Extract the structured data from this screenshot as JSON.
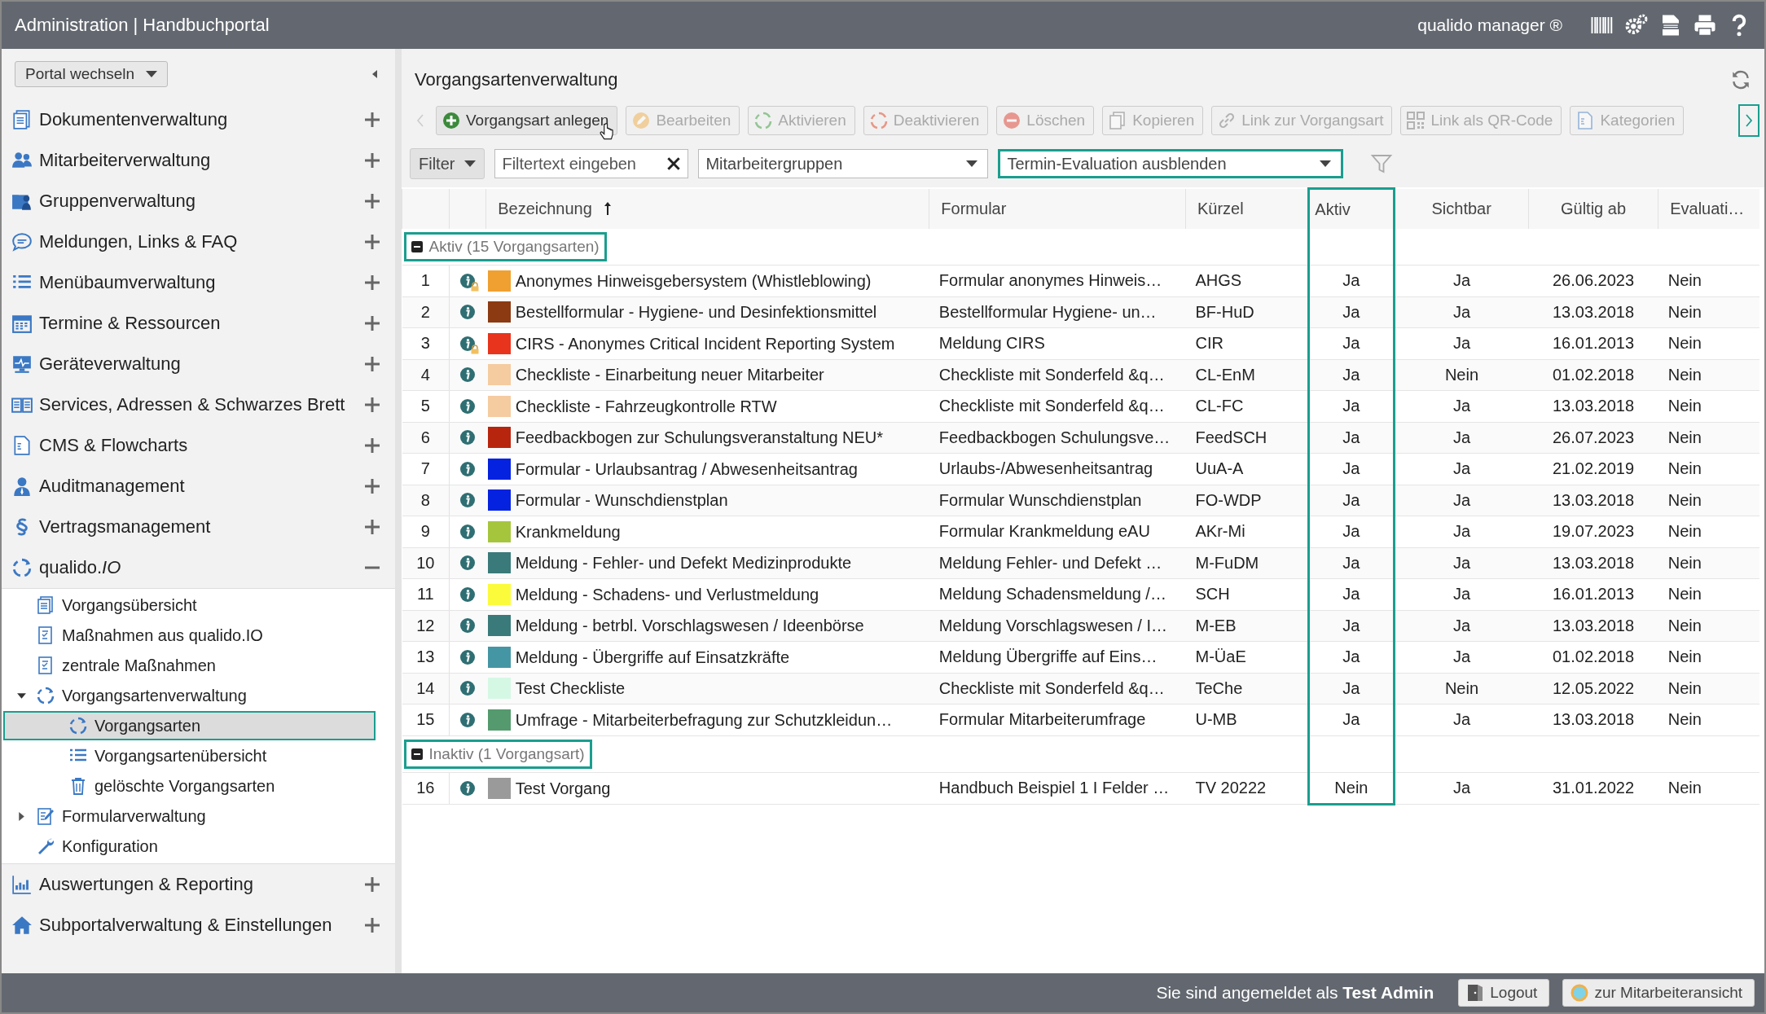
{
  "header": {
    "title": "Administration | Handbuchportal",
    "product": "qualido manager ®"
  },
  "sidebar": {
    "portal_button": "Portal wechseln",
    "items": [
      {
        "label": "Dokumentenverwaltung",
        "expanded": false
      },
      {
        "label": "Mitarbeiterverwaltung",
        "expanded": false
      },
      {
        "label": "Gruppenverwaltung",
        "expanded": false
      },
      {
        "label": "Meldungen, Links & FAQ",
        "expanded": false
      },
      {
        "label": "Menübaumverwaltung",
        "expanded": false
      },
      {
        "label": "Termine & Ressourcen",
        "expanded": false
      },
      {
        "label": "Geräteverwaltung",
        "expanded": false
      },
      {
        "label": "Services, Adressen & Schwarzes Brett",
        "expanded": false
      },
      {
        "label": "CMS & Flowcharts",
        "expanded": false
      },
      {
        "label": "Auditmanagement",
        "expanded": false
      },
      {
        "label": "Vertragsmanagement",
        "expanded": false
      },
      {
        "label": "qualido.*IO*",
        "expanded": true,
        "children": [
          {
            "label": "Vorgangsübersicht",
            "selected": false
          },
          {
            "label": "Maßnahmen aus qualido.IO",
            "selected": false
          },
          {
            "label": "zentrale Maßnahmen",
            "selected": false
          },
          {
            "label": "Vorgangsartenverwaltung",
            "selected": false,
            "expanded": true,
            "children": [
              {
                "label": "Vorgangsarten",
                "selected": true
              },
              {
                "label": "Vorgangsartenübersicht",
                "selected": false
              },
              {
                "label": "gelöschte Vorgangsarten",
                "selected": false
              }
            ]
          },
          {
            "label": "Formularverwaltung",
            "selected": false,
            "expanded": false
          },
          {
            "label": "Konfiguration",
            "selected": false
          }
        ]
      },
      {
        "label": "Auswertungen & Reporting",
        "expanded": false
      },
      {
        "label": "Subportalverwaltung & Einstellungen",
        "expanded": false
      }
    ]
  },
  "main": {
    "title": "Vorgangsartenverwaltung",
    "toolbar": {
      "scroll_left": {
        "disabled": true
      },
      "scroll_right": {
        "highlighted": true
      },
      "buttons": [
        {
          "label": "Vorgangsart anlegen",
          "disabled": false
        },
        {
          "label": "Bearbeiten",
          "disabled": true
        },
        {
          "label": "Aktivieren",
          "disabled": true
        },
        {
          "label": "Deaktivieren",
          "disabled": true
        },
        {
          "label": "Löschen",
          "disabled": true
        },
        {
          "label": "Kopieren",
          "disabled": true
        },
        {
          "label": "Link zur Vorgangsart",
          "disabled": true
        },
        {
          "label": "Link als QR-Code",
          "disabled": true
        },
        {
          "label": "Kategorien",
          "disabled": true
        }
      ]
    },
    "filters": {
      "filter_button": "Filter",
      "text_field": {
        "placeholder": "Filtertext eingeben"
      },
      "group_select": {
        "value": "Mitarbeitergruppen",
        "highlighted": false
      },
      "evaluation_select": {
        "value": "Termin-Evaluation ausblenden",
        "highlighted": true
      }
    },
    "table": {
      "columns": [
        {
          "highlighted": false
        },
        {
          "highlighted": false
        },
        {
          "label": "Bezeichnung",
          "sorted": true,
          "highlighted": false
        },
        {
          "label": "Formular",
          "highlighted": false
        },
        {
          "label": "Kürzel",
          "highlighted": false
        },
        {
          "label": "Aktiv",
          "highlighted": true
        },
        {
          "label": "Sichtbar",
          "highlighted": false
        },
        {
          "label": "Gültig ab",
          "highlighted": false
        },
        {
          "label": "Evaluati…",
          "highlighted": false
        }
      ],
      "groups": [
        {
          "label": "Aktiv (15 Vorgangsarten)",
          "expanded": true,
          "highlighted": true,
          "rows": [
            {
              "nr": "1",
              "locked": true,
              "color": "#f0a030",
              "name": "Anonymes Hinweisgebersystem (Whistleblowing)",
              "form": "Formular anonymes Hinweis…",
              "short": "AHGS",
              "active": "Ja",
              "visible": "Ja",
              "valid": "26.06.2023",
              "eval": "Nein"
            },
            {
              "nr": "2",
              "locked": false,
              "color": "#8b3a12",
              "name": "Bestellformular - Hygiene- und Desinfektionsmittel",
              "form": "Bestellformular Hygiene- un…",
              "short": "BF-HuD",
              "active": "Ja",
              "visible": "Ja",
              "valid": "13.03.2018",
              "eval": "Nein"
            },
            {
              "nr": "3",
              "locked": true,
              "color": "#e8341c",
              "name": "CIRS - Anonymes Critical Incident Reporting System",
              "form": "Meldung CIRS",
              "short": "CIR",
              "active": "Ja",
              "visible": "Ja",
              "valid": "16.01.2013",
              "eval": "Nein"
            },
            {
              "nr": "4",
              "locked": false,
              "color": "#f5cba0",
              "name": "Checkliste - Einarbeitung neuer Mitarbeiter",
              "form": "Checkliste mit Sonderfeld &q…",
              "short": "CL-EnM",
              "active": "Ja",
              "visible": "Nein",
              "valid": "01.02.2018",
              "eval": "Nein"
            },
            {
              "nr": "5",
              "locked": false,
              "color": "#f5cba0",
              "name": "Checkliste - Fahrzeugkontrolle RTW",
              "form": "Checkliste mit Sonderfeld &q…",
              "short": "CL-FC",
              "active": "Ja",
              "visible": "Ja",
              "valid": "13.03.2018",
              "eval": "Nein"
            },
            {
              "nr": "6",
              "locked": false,
              "color": "#b8250e",
              "name": "Feedbackbogen zur Schulungsveranstaltung NEU*",
              "form": "Feedbackbogen Schulungsve…",
              "short": "FeedSCH",
              "active": "Ja",
              "visible": "Ja",
              "valid": "26.07.2023",
              "eval": "Nein"
            },
            {
              "nr": "7",
              "locked": false,
              "color": "#0522e0",
              "name": "Formular - Urlaubsantrag / Abwesenheitsantrag",
              "form": "Urlaubs-/Abwesenheitsantrag",
              "short": "UuA-A",
              "active": "Ja",
              "visible": "Ja",
              "valid": "21.02.2019",
              "eval": "Nein"
            },
            {
              "nr": "8",
              "locked": false,
              "color": "#0522e0",
              "name": "Formular - Wunschdienstplan",
              "form": "Formular Wunschdienstplan",
              "short": "FO-WDP",
              "active": "Ja",
              "visible": "Ja",
              "valid": "13.03.2018",
              "eval": "Nein"
            },
            {
              "nr": "9",
              "locked": false,
              "color": "#a5c63c",
              "name": "Krankmeldung",
              "form": "Formular Krankmeldung eAU",
              "short": "AKr-Mi",
              "active": "Ja",
              "visible": "Ja",
              "valid": "19.07.2023",
              "eval": "Nein"
            },
            {
              "nr": "10",
              "locked": false,
              "color": "#3a7a7a",
              "name": "Meldung - Fehler- und Defekt Medizinprodukte",
              "form": "Meldung Fehler- und Defekt …",
              "short": "M-FuDM",
              "active": "Ja",
              "visible": "Ja",
              "valid": "13.03.2018",
              "eval": "Nein"
            },
            {
              "nr": "11",
              "locked": false,
              "color": "#fbfb3c",
              "name": "Meldung - Schadens- und Verlustmeldung",
              "form": "Meldung Schadensmeldung /…",
              "short": "SCH",
              "active": "Ja",
              "visible": "Ja",
              "valid": "16.01.2013",
              "eval": "Nein"
            },
            {
              "nr": "12",
              "locked": false,
              "color": "#3a7a7a",
              "name": "Meldung - betrbl. Vorschlagswesen / Ideenbörse",
              "form": "Meldung Vorschlagswesen / I…",
              "short": "M-EB",
              "active": "Ja",
              "visible": "Ja",
              "valid": "13.03.2018",
              "eval": "Nein"
            },
            {
              "nr": "13",
              "locked": false,
              "color": "#4596a5",
              "name": "Meldung - Übergriffe auf Einsatzkräfte",
              "form": "Meldung Übergriffe auf Eins…",
              "short": "M-ÜaE",
              "active": "Ja",
              "visible": "Ja",
              "valid": "01.02.2018",
              "eval": "Nein"
            },
            {
              "nr": "14",
              "locked": false,
              "color": "#d5f8e5",
              "name": "Test Checkliste",
              "form": "Checkliste mit Sonderfeld &q…",
              "short": "TeChe",
              "active": "Ja",
              "visible": "Nein",
              "valid": "12.05.2022",
              "eval": "Nein"
            },
            {
              "nr": "15",
              "locked": false,
              "color": "#559a6e",
              "name": "Umfrage - Mitarbeiterbefragung zur Schutzkleidun…",
              "form": "Formular Mitarbeiterumfrage",
              "short": "U-MB",
              "active": "Ja",
              "visible": "Ja",
              "valid": "13.03.2018",
              "eval": "Nein"
            }
          ]
        },
        {
          "label": "Inaktiv (1 Vorgangsart)",
          "expanded": true,
          "highlighted": true,
          "rows": [
            {
              "nr": "16",
              "locked": false,
              "color": "#9a9a9a",
              "name": "Test Vorgang",
              "form": "Handbuch Beispiel 1 I Felder …",
              "short": "TV 20222",
              "active": "Nein",
              "visible": "Ja",
              "valid": "31.01.2022",
              "eval": "Nein"
            }
          ]
        }
      ]
    }
  },
  "footer": {
    "login_text": "Sie sind angemeldet als **Test Admin**",
    "buttons": [
      "Logout",
      "zur Mitarbeiteransicht"
    ]
  }
}
